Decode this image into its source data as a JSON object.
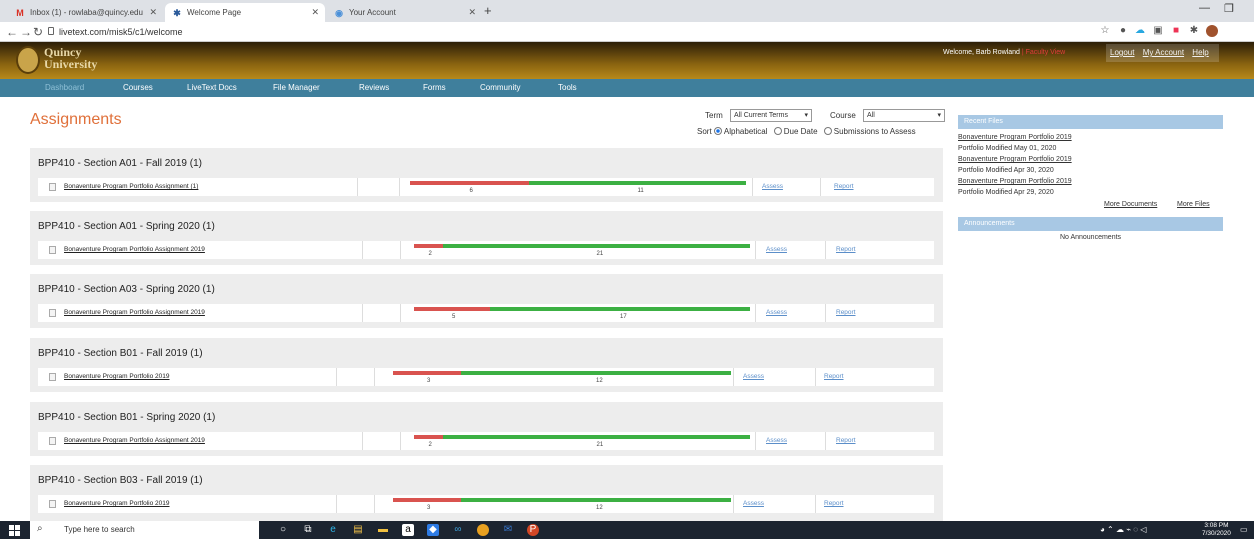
{
  "browser": {
    "tabs": [
      {
        "title": "Inbox (1) - rowlaba@quincy.edu",
        "favicon": "gmail-icon"
      },
      {
        "title": "Welcome Page",
        "favicon": "livetext-icon"
      },
      {
        "title": "Your Account",
        "favicon": "account-icon"
      }
    ],
    "url": "livetext.com/misk5/c1/welcome"
  },
  "header": {
    "logo_line1": "Quincy",
    "logo_line2": "University",
    "welcome": "Welcome, Barb Rowland",
    "separator": "|",
    "faculty_view": "Faculty View",
    "links": [
      "Logout",
      "My Account",
      "Help"
    ]
  },
  "nav": {
    "items": [
      "Dashboard",
      "Courses",
      "LiveText Docs",
      "File Manager",
      "Reviews",
      "Forms",
      "Community",
      "Tools"
    ]
  },
  "main": {
    "title": "Assignments",
    "term_label": "Term",
    "term_value": "All Current Terms",
    "course_label": "Course",
    "course_value": "All",
    "sort_label": "Sort",
    "sort_options": [
      "Alphabetical",
      "Due Date",
      "Submissions to Assess"
    ],
    "sort_selected": "Alphabetical",
    "assess_label": "Assess",
    "report_label": "Report",
    "groups": [
      {
        "heading": "BPP410 - Section A01 - Fall 2019 (1)",
        "assignment": "Bonaventure Program Portfolio Assignment (1)",
        "red": 6,
        "green": 11
      },
      {
        "heading": "BPP410 - Section A01 - Spring 2020 (1)",
        "assignment": "Bonaventure Program Portfolio Assignment 2019",
        "red": 2,
        "green": 21
      },
      {
        "heading": "BPP410 - Section A03 - Spring 2020 (1)",
        "assignment": "Bonaventure Program Portfolio Assignment 2019",
        "red": 5,
        "green": 17
      },
      {
        "heading": "BPP410 - Section B01 - Fall 2019 (1)",
        "assignment": "Bonaventure Program Portfolio 2019",
        "red": 3,
        "green": 12
      },
      {
        "heading": "BPP410 - Section B01 - Spring 2020 (1)",
        "assignment": "Bonaventure Program Portfolio Assignment 2019",
        "red": 2,
        "green": 21
      },
      {
        "heading": "BPP410 - Section B03 - Fall 2019 (1)",
        "assignment": "Bonaventure Program Portfolio 2019",
        "red": 3,
        "green": 12
      }
    ]
  },
  "sidebar": {
    "recent_files_title": "Recent Files",
    "recent_files": [
      {
        "name": "Bonaventure Program Portfolio 2019",
        "modified": "Portfolio Modified May 01, 2020"
      },
      {
        "name": "Bonaventure Program Portfolio 2019",
        "modified": "Portfolio Modified Apr 30, 2020"
      },
      {
        "name": "Bonaventure Program Portfolio 2019",
        "modified": "Portfolio Modified Apr 29, 2020"
      }
    ],
    "more_documents": "More Documents",
    "more_files": "More Files",
    "announcements_title": "Announcements",
    "no_announcements": "No Announcements"
  },
  "taskbar": {
    "search_placeholder": "Type here to search",
    "time": "3:08 PM",
    "date": "7/30/2020"
  },
  "colors": {
    "accent_orange": "#e0703a",
    "nav_blue": "#3f7f9c",
    "bar_red": "#d9534f",
    "bar_green": "#3cb043",
    "link_blue": "#5b8ec9"
  }
}
